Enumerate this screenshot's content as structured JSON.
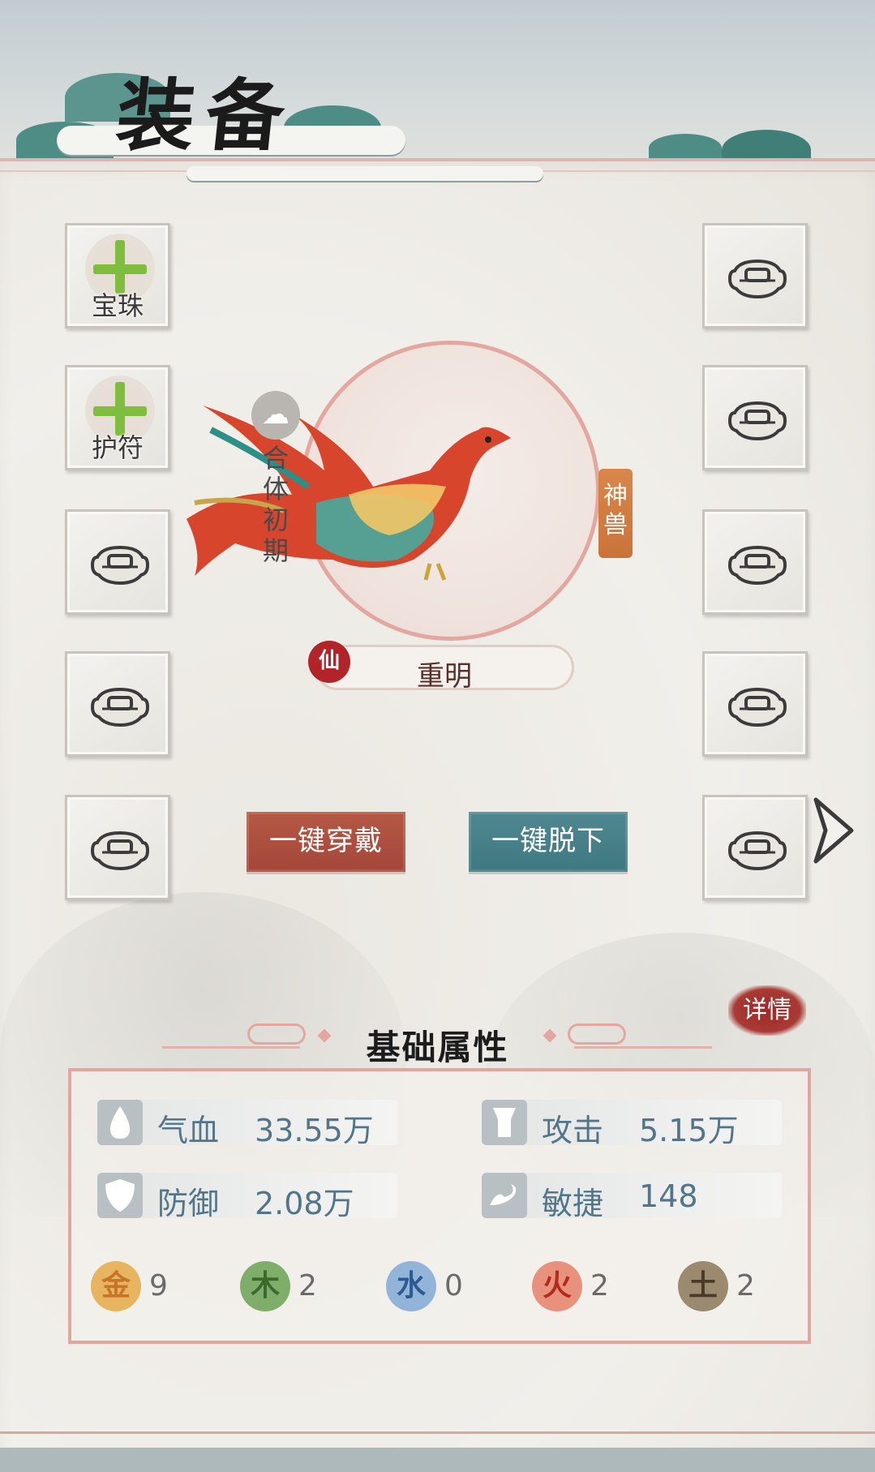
{
  "title": "装备",
  "left_slots": [
    {
      "type": "add",
      "label": "宝珠"
    },
    {
      "type": "add",
      "label": "护符"
    },
    {
      "type": "locked",
      "label": ""
    },
    {
      "type": "locked",
      "label": ""
    },
    {
      "type": "locked",
      "label": ""
    }
  ],
  "right_slots": [
    {
      "type": "locked"
    },
    {
      "type": "locked"
    },
    {
      "type": "locked"
    },
    {
      "type": "locked"
    },
    {
      "type": "locked"
    }
  ],
  "pet": {
    "realm": "合体初期",
    "category_tag": "神兽",
    "rank_badge": "仙",
    "name": "重明"
  },
  "buttons": {
    "equip_all": "一键穿戴",
    "unequip_all": "一键脱下"
  },
  "details_label": "详情",
  "attributes": {
    "section_title": "基础属性",
    "stats": [
      {
        "name": "气血",
        "value": "33.55万",
        "icon": "blood-drop-icon"
      },
      {
        "name": "攻击",
        "value": "5.15万",
        "icon": "attack-icon"
      },
      {
        "name": "防御",
        "value": "2.08万",
        "icon": "shield-icon"
      },
      {
        "name": "敏捷",
        "value": "148",
        "icon": "wind-icon"
      }
    ],
    "elements": [
      {
        "glyph": "金",
        "count": "9",
        "color": "#e7b560",
        "text_color": "#c7742a"
      },
      {
        "glyph": "木",
        "count": "2",
        "color": "#7fae6b",
        "text_color": "#3c6a2e"
      },
      {
        "glyph": "水",
        "count": "0",
        "color": "#92b4d8",
        "text_color": "#2d5a90"
      },
      {
        "glyph": "火",
        "count": "2",
        "color": "#e8927e",
        "text_color": "#b22a20"
      },
      {
        "glyph": "土",
        "count": "2",
        "color": "#9c8a70",
        "text_color": "#4a3a28"
      }
    ]
  },
  "colors": {
    "accent_red": "#a4473a",
    "accent_teal": "#3e7880",
    "frame_pink": "#e1a6a0"
  }
}
